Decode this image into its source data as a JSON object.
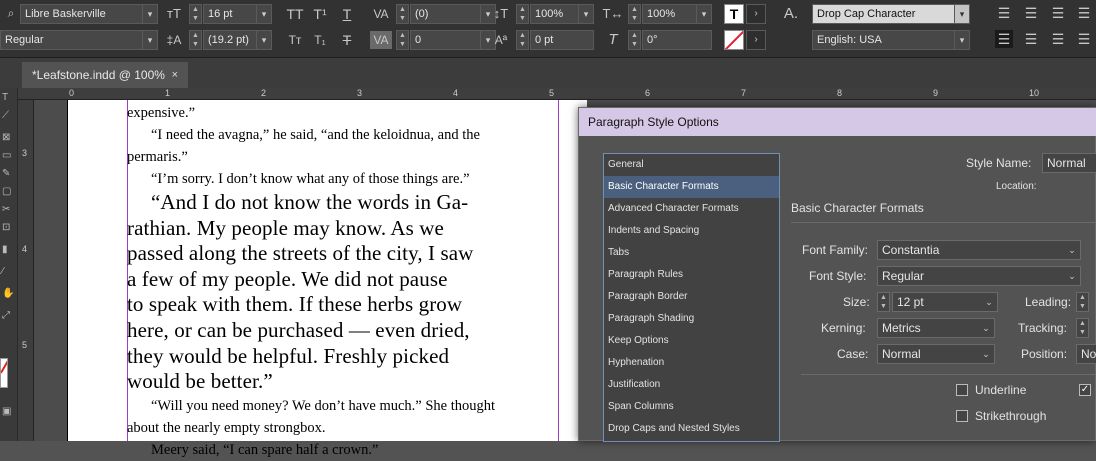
{
  "control_panel": {
    "font_family": "Libre Baskerville",
    "font_style": "Regular",
    "font_size": "16 pt",
    "leading": "(19.2 pt)",
    "tracking": "(0)",
    "kerning": "0",
    "vertical_scale": "100%",
    "horizontal_scale": "100%",
    "baseline_shift": "0 pt",
    "skew": "0°",
    "char_style": "Drop Cap Character",
    "language": "English: USA"
  },
  "tab": {
    "title": "*Leafstone.indd @ 100%",
    "close": "×"
  },
  "ruler": {
    "h": [
      "0",
      "1",
      "2",
      "3",
      "4",
      "5",
      "6",
      "7",
      "8",
      "9",
      "10"
    ],
    "v": [
      "3",
      "4",
      "5"
    ]
  },
  "document": {
    "lines": [
      {
        "t": "expensive.”",
        "cls": "s"
      },
      {
        "t": "“I need the avagna,” he said, “and the keloidnua, and the",
        "cls": "s ind"
      },
      {
        "t": "permaris.”",
        "cls": "s"
      },
      {
        "t": "“I’m sorry. I don’t know what any of those things are.”",
        "cls": "s ind"
      },
      {
        "t": "“And I do not know the words in Ga-",
        "cls": "b ind"
      },
      {
        "t": "rathian. My people may know. As we",
        "cls": "b"
      },
      {
        "t": "passed along the streets of the city, I saw",
        "cls": "b"
      },
      {
        "t": "a few of my people. We did not pause",
        "cls": "b"
      },
      {
        "t": "to speak with them. If these herbs grow",
        "cls": "b"
      },
      {
        "t": "here, or can be purchased — even dried,",
        "cls": "b"
      },
      {
        "t": "they would be helpful. Freshly picked",
        "cls": "b"
      },
      {
        "t": "would be better.”",
        "cls": "b"
      },
      {
        "t": "“Will you need money? We don’t have much.” She thought",
        "cls": "s ind"
      },
      {
        "t": "about the nearly empty strongbox.",
        "cls": "s"
      },
      {
        "t": "Meery said, “I can spare half a crown.”",
        "cls": "s ind"
      }
    ]
  },
  "dialog": {
    "title": "Paragraph Style Options",
    "list": [
      "General",
      "Basic Character Formats",
      "Advanced Character Formats",
      "Indents and Spacing",
      "Tabs",
      "Paragraph Rules",
      "Paragraph Border",
      "Paragraph Shading",
      "Keep Options",
      "Hyphenation",
      "Justification",
      "Span Columns",
      "Drop Caps and Nested Styles"
    ],
    "selected_index": 1,
    "style_name_label": "Style Name:",
    "style_name": "Normal",
    "location_label": "Location:",
    "section": "Basic Character Formats",
    "font_family_label": "Font Family:",
    "font_family": "Constantia",
    "font_style_label": "Font Style:",
    "font_style": "Regular",
    "size_label": "Size:",
    "size": "12 pt",
    "leading_label": "Leading:",
    "kerning_label": "Kerning:",
    "kerning": "Metrics",
    "tracking_label": "Tracking:",
    "case_label": "Case:",
    "case": "Normal",
    "position_label": "Position:",
    "position": "No",
    "underline_label": "Underline",
    "strikethrough_label": "Strikethrough"
  }
}
